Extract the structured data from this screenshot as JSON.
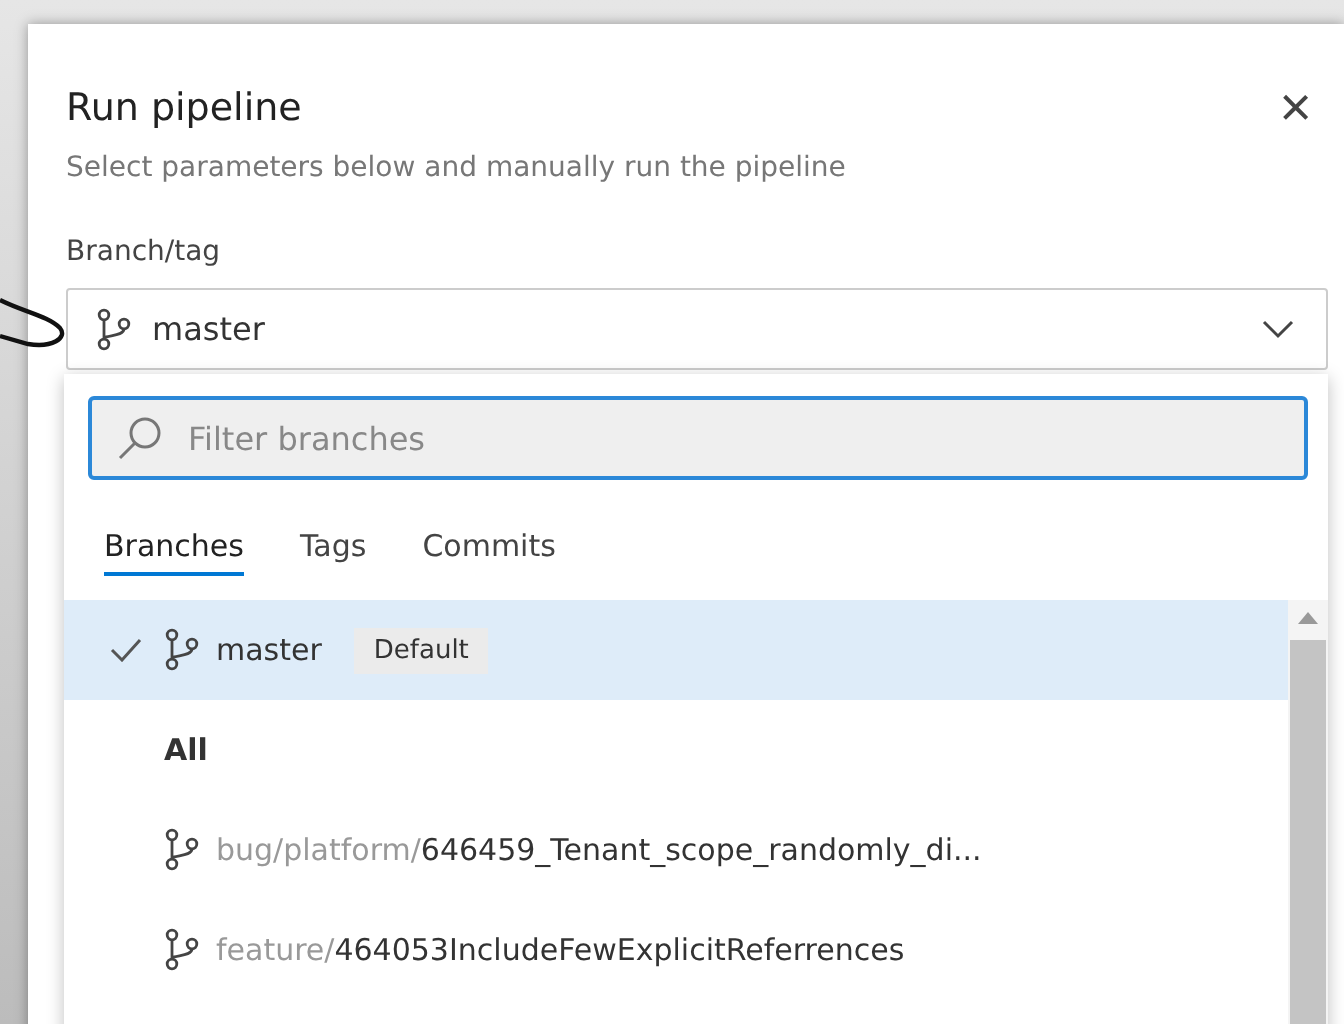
{
  "dialog": {
    "title": "Run pipeline",
    "subtitle": "Select parameters below and manually run the pipeline",
    "close": "×"
  },
  "branch_field": {
    "label": "Branch/tag",
    "value": "master"
  },
  "dropdown": {
    "filter": {
      "placeholder": "Filter branches"
    },
    "tabs": [
      {
        "label": "Branches",
        "selected": true
      },
      {
        "label": "Tags",
        "selected": false
      },
      {
        "label": "Commits",
        "selected": false
      }
    ],
    "items": [
      {
        "kind": "branch",
        "name": "master",
        "badge": "Default",
        "selected": true
      },
      {
        "kind": "header",
        "name": "All",
        "selected": false
      },
      {
        "kind": "branch",
        "prefix": "bug/platform/",
        "name": "646459_Tenant_scope_randomly_di...",
        "selected": false
      },
      {
        "kind": "branch",
        "prefix": "feature/",
        "name": "464053IncludeFewExplicitReferrences",
        "selected": false
      }
    ]
  }
}
